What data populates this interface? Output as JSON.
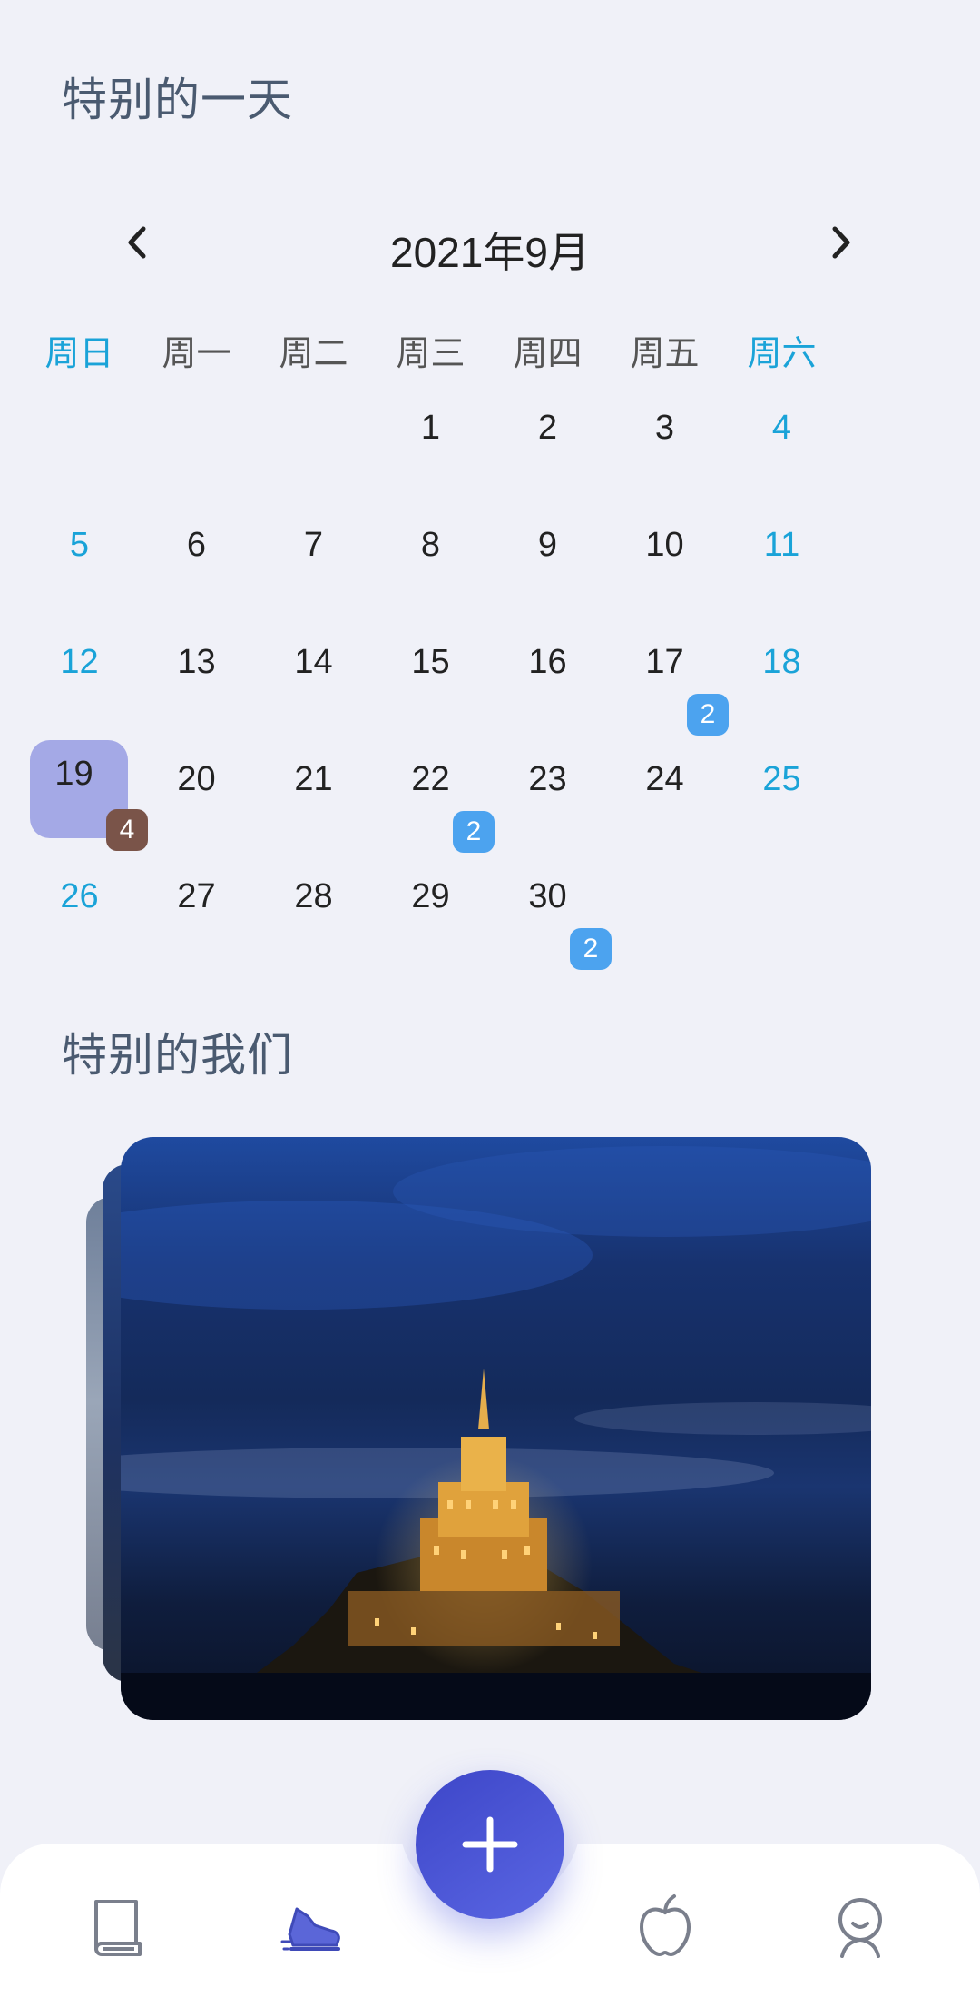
{
  "sections": {
    "special_day_title": "特别的一天",
    "special_us_title": "特别的我们"
  },
  "calendar": {
    "month_label": "2021年9月",
    "weekdays": [
      "周日",
      "周一",
      "周二",
      "周三",
      "周四",
      "周五",
      "周六"
    ],
    "days": [
      {
        "n": "1",
        "col": 3,
        "row": 0
      },
      {
        "n": "2",
        "col": 4,
        "row": 0
      },
      {
        "n": "3",
        "col": 5,
        "row": 0
      },
      {
        "n": "4",
        "col": 6,
        "row": 0
      },
      {
        "n": "5",
        "col": 0,
        "row": 1
      },
      {
        "n": "6",
        "col": 1,
        "row": 1
      },
      {
        "n": "7",
        "col": 2,
        "row": 1
      },
      {
        "n": "8",
        "col": 3,
        "row": 1
      },
      {
        "n": "9",
        "col": 4,
        "row": 1
      },
      {
        "n": "10",
        "col": 5,
        "row": 1
      },
      {
        "n": "11",
        "col": 6,
        "row": 1
      },
      {
        "n": "12",
        "col": 0,
        "row": 2
      },
      {
        "n": "13",
        "col": 1,
        "row": 2
      },
      {
        "n": "14",
        "col": 2,
        "row": 2
      },
      {
        "n": "15",
        "col": 3,
        "row": 2
      },
      {
        "n": "16",
        "col": 4,
        "row": 2
      },
      {
        "n": "17",
        "col": 5,
        "row": 2,
        "badge": "2"
      },
      {
        "n": "18",
        "col": 6,
        "row": 2
      },
      {
        "n": "19",
        "col": 0,
        "row": 3,
        "badge": "4",
        "selected": true
      },
      {
        "n": "20",
        "col": 1,
        "row": 3
      },
      {
        "n": "21",
        "col": 2,
        "row": 3
      },
      {
        "n": "22",
        "col": 3,
        "row": 3,
        "badge": "2"
      },
      {
        "n": "23",
        "col": 4,
        "row": 3
      },
      {
        "n": "24",
        "col": 5,
        "row": 3
      },
      {
        "n": "25",
        "col": 6,
        "row": 3
      },
      {
        "n": "26",
        "col": 0,
        "row": 4
      },
      {
        "n": "27",
        "col": 1,
        "row": 4
      },
      {
        "n": "28",
        "col": 2,
        "row": 4
      },
      {
        "n": "29",
        "col": 3,
        "row": 4
      },
      {
        "n": "30",
        "col": 4,
        "row": 4,
        "badge": "2"
      }
    ]
  },
  "colors": {
    "weekend": "#1aa3d8",
    "badge_blue": "#4ca3ef",
    "badge_brown": "#7a5449",
    "selected_bg": "#a4a9e6",
    "fab": "#4a55d6"
  },
  "icons": {
    "prev": "chevron-left-icon",
    "next": "chevron-right-icon",
    "fab": "plus-icon",
    "tabs": [
      "book-icon",
      "sneaker-icon",
      "apple-icon",
      "profile-icon"
    ]
  }
}
